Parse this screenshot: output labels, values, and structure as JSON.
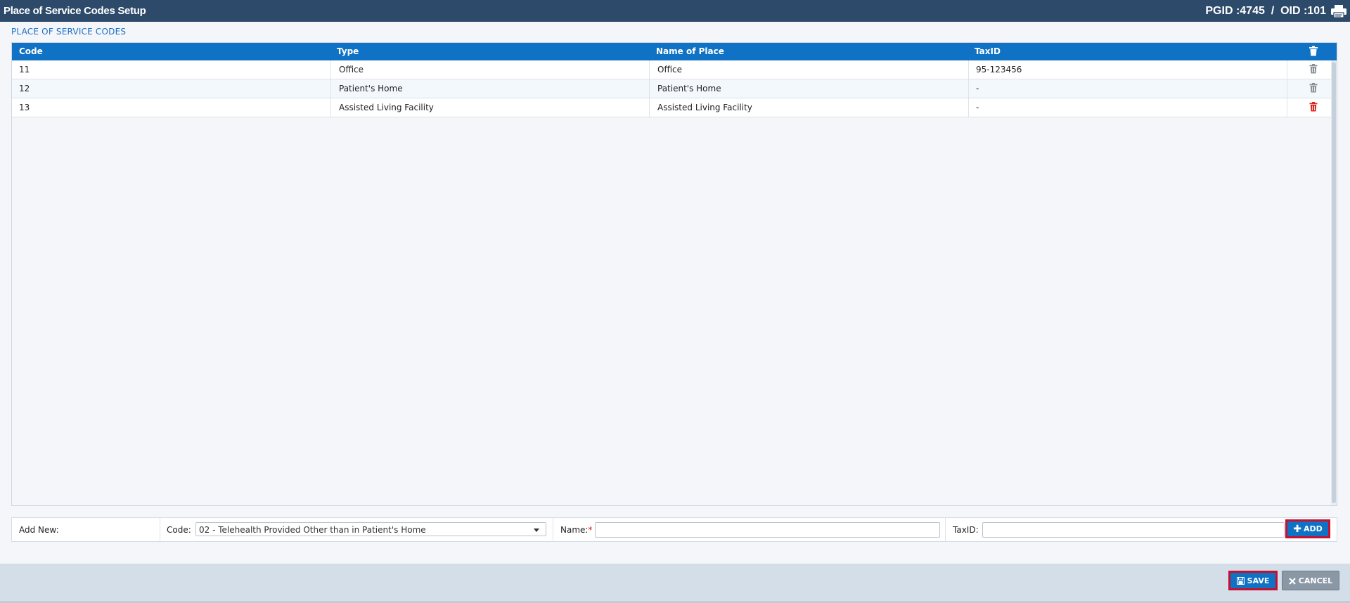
{
  "titlebar": {
    "title": "Place of Service Codes Setup",
    "ids": "PGID :4745  /  OID :101",
    "print_icon": "printer-icon"
  },
  "section_title": "PLACE OF SERVICE CODES",
  "table": {
    "columns": [
      "Code",
      "Type",
      "Name of Place",
      "TaxID"
    ],
    "rows": [
      {
        "code": "11",
        "type": "Office",
        "name": "Office",
        "taxid": "95-123456",
        "trash_color": "#8a8f96"
      },
      {
        "code": "12",
        "type": "Patient's Home",
        "name": "Patient's Home",
        "taxid": "-",
        "trash_color": "#8a8f96"
      },
      {
        "code": "13",
        "type": "Assisted Living Facility",
        "name": "Assisted Living Facility",
        "taxid": "-",
        "trash_color": "#d9261c"
      }
    ]
  },
  "add_new": {
    "label": "Add New:",
    "code_label": "Code:",
    "code_value": "02 - Telehealth Provided Other than in Patient's Home",
    "name_label": "Name:",
    "name_required_mark": "*",
    "name_value": "",
    "taxid_label": "TaxID:",
    "taxid_value": "",
    "add_label": "ADD"
  },
  "footer": {
    "save_label": "SAVE",
    "cancel_label": "CANCEL"
  },
  "colors": {
    "titlebar": "#2e4a6b",
    "accent": "#0f72c4",
    "highlight_border": "#c8102e"
  }
}
